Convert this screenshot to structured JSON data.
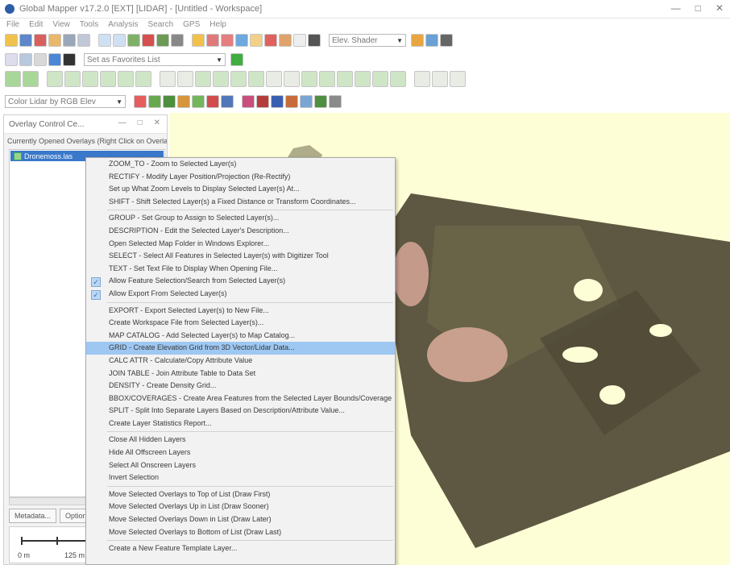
{
  "window": {
    "title": "Global Mapper v17.2.0 [EXT] [LIDAR] - [Untitled - Workspace]",
    "controls": [
      "—",
      "□",
      "✕"
    ]
  },
  "menubar": [
    "File",
    "Edit",
    "View",
    "Tools",
    "Analysis",
    "Search",
    "GPS",
    "Help"
  ],
  "toolbars": {
    "render_combo": "Elev. Shader",
    "search_combo": "Set as Favorites List",
    "color_combo": "Color Lidar by RGB Elev"
  },
  "panel": {
    "title": "Overlay Control Ce...",
    "controls": [
      "—",
      "□",
      "✕"
    ],
    "caption": "Currently Opened Overlays (Right Click on Overlay Name)",
    "layer_name": "Dronemoss.las",
    "tabs": [
      "Metadata...",
      "Options"
    ],
    "scale": {
      "left_label": "0 m",
      "right_label": "125 m"
    }
  },
  "context_menu": {
    "items": [
      {
        "label": "ZOOM_TO - Zoom to Selected Layer(s)"
      },
      {
        "label": "RECTIFY - Modify Layer Position/Projection (Re-Rectify)"
      },
      {
        "label": "Set up What Zoom Levels to Display Selected Layer(s) At..."
      },
      {
        "label": "SHIFT - Shift Selected Layer(s) a Fixed Distance or Transform Coordinates..."
      },
      {
        "sep": true
      },
      {
        "label": "GROUP - Set Group to Assign to Selected Layer(s)..."
      },
      {
        "label": "DESCRIPTION - Edit the Selected Layer's Description..."
      },
      {
        "label": "Open Selected Map Folder in Windows Explorer..."
      },
      {
        "label": "SELECT - Select All Features in Selected Layer(s) with Digitizer Tool"
      },
      {
        "label": "TEXT - Set Text File to Display When Opening File..."
      },
      {
        "label": "Allow Feature Selection/Search from Selected Layer(s)",
        "checked": true
      },
      {
        "label": "Allow Export From Selected Layer(s)",
        "checked": true
      },
      {
        "sep": true
      },
      {
        "label": "EXPORT - Export Selected Layer(s) to New File..."
      },
      {
        "label": "Create Workspace File from Selected Layer(s)..."
      },
      {
        "label": "MAP CATALOG - Add Selected Layer(s) to Map Catalog..."
      },
      {
        "label": "GRID - Create Elevation Grid from 3D Vector/Lidar Data...",
        "highlighted": true
      },
      {
        "label": "CALC ATTR - Calculate/Copy Attribute Value"
      },
      {
        "label": "JOIN TABLE - Join Attribute Table to Data Set"
      },
      {
        "label": "DENSITY - Create Density Grid..."
      },
      {
        "label": "BBOX/COVERAGES - Create Area Features from the Selected Layer Bounds/Coverage"
      },
      {
        "label": "SPLIT - Split Into Separate Layers Based on Description/Attribute Value..."
      },
      {
        "label": "Create Layer Statistics Report..."
      },
      {
        "sep": true
      },
      {
        "label": "Close All Hidden Layers"
      },
      {
        "label": "Hide All Offscreen Layers"
      },
      {
        "label": "Select All Onscreen Layers"
      },
      {
        "label": "Invert Selection"
      },
      {
        "sep": true
      },
      {
        "label": "Move Selected Overlays to Top of List (Draw First)"
      },
      {
        "label": "Move Selected Overlays Up in List (Draw Sooner)"
      },
      {
        "label": "Move Selected Overlays Down in List (Draw Later)"
      },
      {
        "label": "Move Selected Overlays to Bottom of List (Draw Last)"
      },
      {
        "sep": true
      },
      {
        "label": "Create a New Feature Template Layer..."
      }
    ]
  },
  "colors": {
    "map_background": "#fefed6",
    "menu_highlight": "#9ec8f2",
    "layer_selected": "#3a78c9"
  }
}
